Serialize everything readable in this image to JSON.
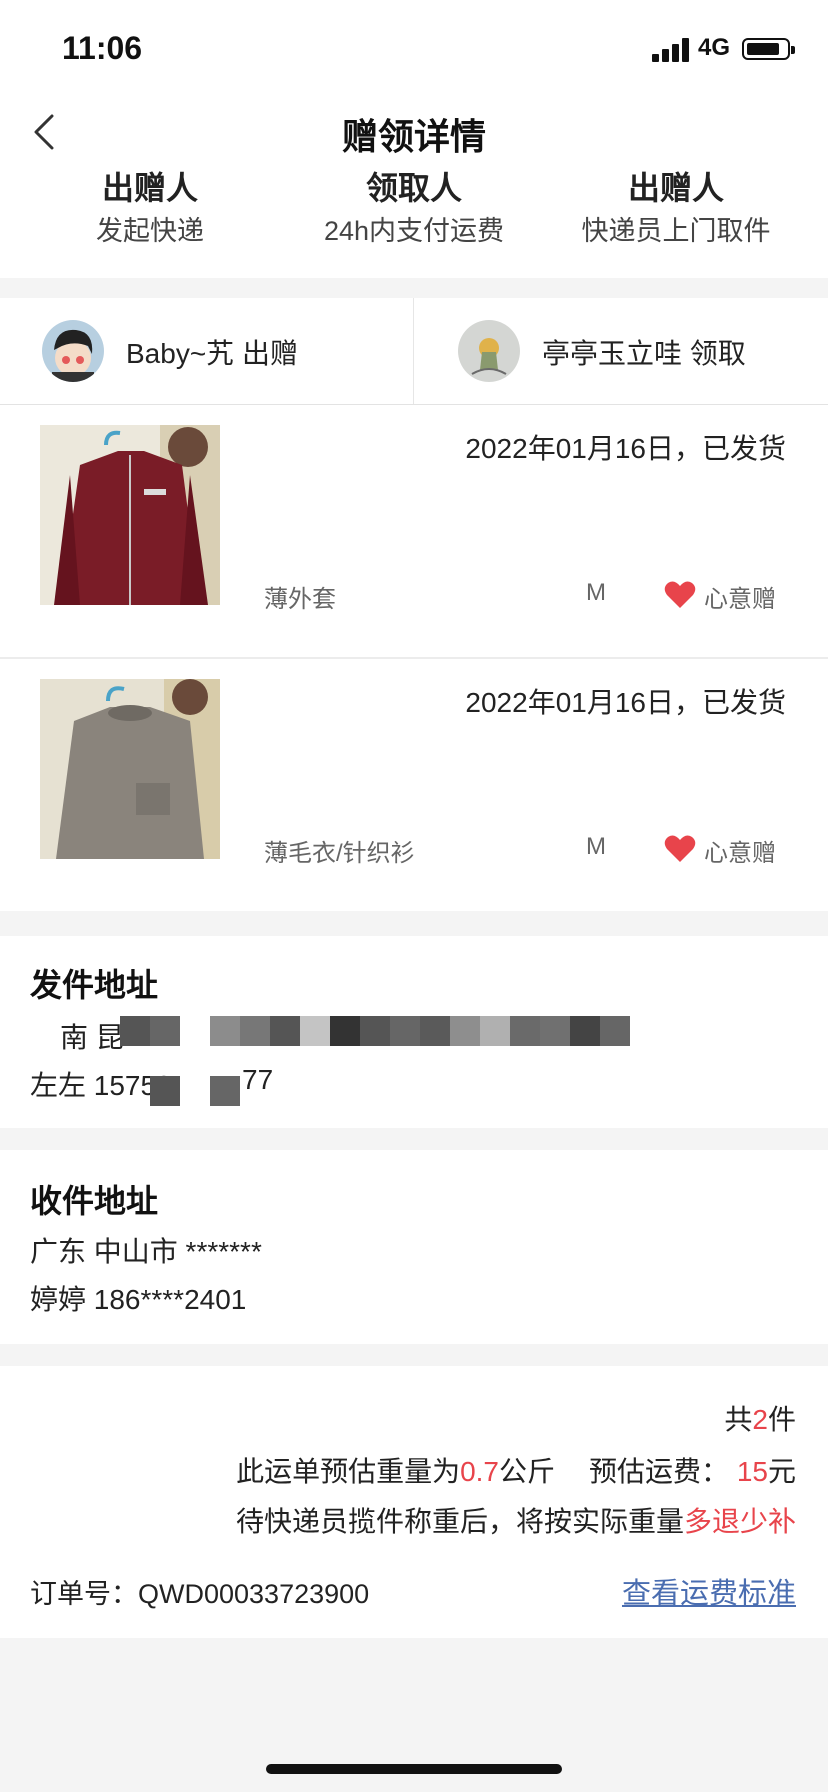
{
  "status": {
    "time": "11:06",
    "network": "4G"
  },
  "nav": {
    "title": "赠领详情"
  },
  "steps": [
    {
      "title": "出赠人",
      "desc": "发起快递"
    },
    {
      "title": "领取人",
      "desc": "24h内支付运费"
    },
    {
      "title": "出赠人",
      "desc": "快递员上门取件"
    }
  ],
  "parties": {
    "giver": "Baby~艽 出赠",
    "receiver": "亭亭玉立哇 领取"
  },
  "items": [
    {
      "date": "2022年01月16日，已发货",
      "name": "薄外套",
      "size": "M",
      "tag": "心意赠",
      "image_color": "#7a1c27"
    },
    {
      "date": "2022年01月16日，已发货",
      "name": "薄毛衣/针织衫",
      "size": "M",
      "tag": "心意赠",
      "image_color": "#8a847c"
    }
  ],
  "send_address": {
    "title": "发件地址",
    "line1": "南 昆",
    "line2": "左左 15758",
    "line2_tail": "77"
  },
  "recv_address": {
    "title": "收件地址",
    "line1": "广东 中山市 *******",
    "line2": "婷婷 186****2401"
  },
  "summary": {
    "count_prefix": "共",
    "count": "2",
    "count_suffix": "件",
    "weight_prefix": "此运单预估重量为",
    "weight": "0.7",
    "weight_unit": "公斤",
    "fee_label": "预估运费：",
    "fee": "15",
    "fee_unit": "元",
    "note_prefix": "待快递员揽件称重后，将按实际重量",
    "note_highlight": "多退少补",
    "order_label": "订单号：",
    "order_no": "QWD00033723900",
    "rate_link": "查看运费标准"
  },
  "colors": {
    "accent_red": "#e8444b",
    "link_blue": "#4a6db0"
  }
}
